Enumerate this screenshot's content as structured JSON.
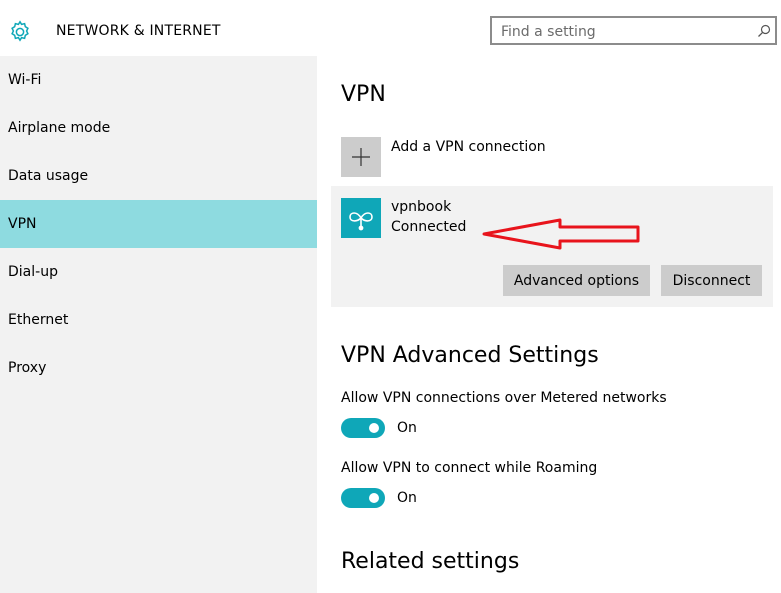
{
  "header": {
    "title": "NETWORK & INTERNET",
    "search_placeholder": "Find a setting"
  },
  "sidebar": {
    "items": [
      {
        "label": "Wi-Fi",
        "selected": false
      },
      {
        "label": "Airplane mode",
        "selected": false
      },
      {
        "label": "Data usage",
        "selected": false
      },
      {
        "label": "VPN",
        "selected": true
      },
      {
        "label": "Dial-up",
        "selected": false
      },
      {
        "label": "Ethernet",
        "selected": false
      },
      {
        "label": "Proxy",
        "selected": false
      }
    ]
  },
  "main": {
    "title": "VPN",
    "add_connection_label": "Add a VPN connection",
    "connection": {
      "name": "vpnbook",
      "status": "Connected",
      "advanced_label": "Advanced options",
      "disconnect_label": "Disconnect"
    },
    "advanced": {
      "title": "VPN Advanced Settings",
      "settings": [
        {
          "label": "Allow VPN connections over Metered networks",
          "state": "On"
        },
        {
          "label": "Allow VPN to connect while Roaming",
          "state": "On"
        }
      ]
    },
    "related_title": "Related settings"
  },
  "colors": {
    "accent": "#0fa7b8",
    "selected_nav": "#8edbe0",
    "annotation_arrow": "#e8141c"
  }
}
